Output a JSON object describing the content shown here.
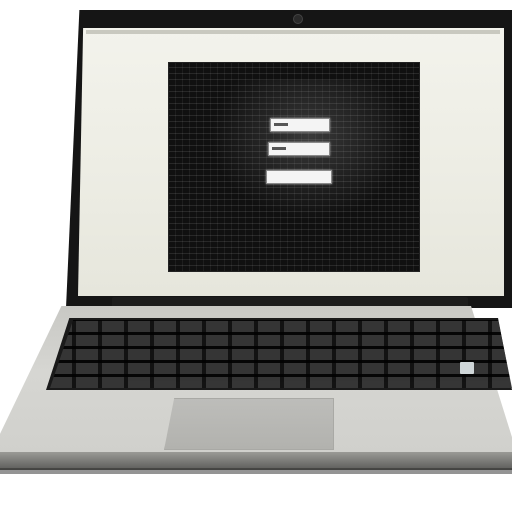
{
  "scene": {
    "subject": "laptop",
    "colors": {
      "background": "#ffffff",
      "lid": "#151515",
      "screen": "#f3f3ec",
      "terminal": "#101010",
      "base": "#d2d2ce",
      "keys": "#2a2a2a",
      "trackpad": "#b7b7b3"
    },
    "screen_windows": 3
  }
}
